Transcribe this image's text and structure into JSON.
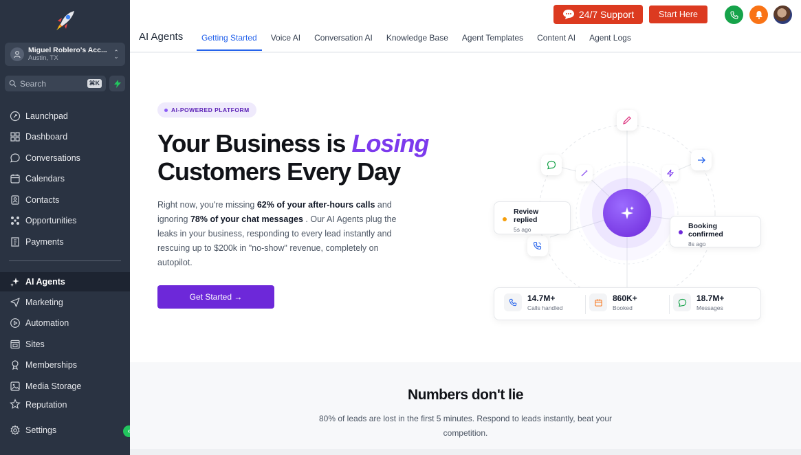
{
  "account": {
    "name": "Miguel Roblero's Acc...",
    "location": "Austin, TX"
  },
  "search": {
    "placeholder": "Search",
    "shortcut": "⌘K"
  },
  "sidebar": {
    "items": [
      {
        "label": "Launchpad",
        "icon": "rocket-circle-icon"
      },
      {
        "label": "Dashboard",
        "icon": "grid-icon"
      },
      {
        "label": "Conversations",
        "icon": "chat-bubble-icon"
      },
      {
        "label": "Calendars",
        "icon": "calendar-icon"
      },
      {
        "label": "Contacts",
        "icon": "contacts-icon"
      },
      {
        "label": "Opportunities",
        "icon": "opportunities-icon"
      },
      {
        "label": "Payments",
        "icon": "receipt-icon"
      }
    ],
    "items2": [
      {
        "label": "AI Agents",
        "icon": "sparkles-icon",
        "active": true
      },
      {
        "label": "Marketing",
        "icon": "send-icon"
      },
      {
        "label": "Automation",
        "icon": "automation-icon"
      },
      {
        "label": "Sites",
        "icon": "sites-icon"
      },
      {
        "label": "Memberships",
        "icon": "membership-icon"
      },
      {
        "label": "Media Storage",
        "icon": "image-icon"
      },
      {
        "label": "Reputation",
        "icon": "star-icon"
      }
    ],
    "settings": "Settings"
  },
  "header": {
    "support_label": "24/7 Support",
    "start_label": "Start Here",
    "title": "AI Agents",
    "tabs": [
      {
        "label": "Getting Started",
        "active": true
      },
      {
        "label": "Voice AI"
      },
      {
        "label": "Conversation AI"
      },
      {
        "label": "Knowledge Base"
      },
      {
        "label": "Agent Templates"
      },
      {
        "label": "Content AI"
      },
      {
        "label": "Agent Logs"
      }
    ]
  },
  "hero": {
    "pill": "AI-POWERED PLATFORM",
    "headline_1": "Your Business is",
    "headline_em": "Losing",
    "headline_2": "Customers Every Day",
    "desc_1": "Right now, you're missing",
    "desc_b1": "62% of your after-hours calls",
    "desc_2": "and ignoring",
    "desc_b2": "78% of your chat messages",
    "desc_3": ". Our AI Agents plug the leaks in your business, responding to every lead instantly and rescuing up to $200k in \"no-show\" revenue, completely on autopilot.",
    "cta": "Get Started →"
  },
  "illustration": {
    "card_left": {
      "title": "Review replied",
      "sub": "5s ago",
      "dot_color": "#f59e0b"
    },
    "card_right": {
      "title": "Booking confirmed",
      "sub": "8s ago",
      "dot_color": "#6d28d9"
    },
    "stats": [
      {
        "value": "14.7M+",
        "label": "Calls handled",
        "icon": "phone-icon",
        "color": "#2563eb"
      },
      {
        "value": "860K+",
        "label": "Booked",
        "icon": "calendar-icon",
        "color": "#f97316"
      },
      {
        "value": "18.7M+",
        "label": "Messages",
        "icon": "message-icon",
        "color": "#16a34a"
      }
    ]
  },
  "numbers": {
    "title": "Numbers don't lie",
    "text": "80% of leads are lost in the first 5 minutes. Respond to leads instantly, beat your competition."
  },
  "colors": {
    "accent": "#6d28d9",
    "tab_active": "#2563eb",
    "brand_red": "#dc3a20",
    "sidebar_bg": "#2a3342"
  }
}
